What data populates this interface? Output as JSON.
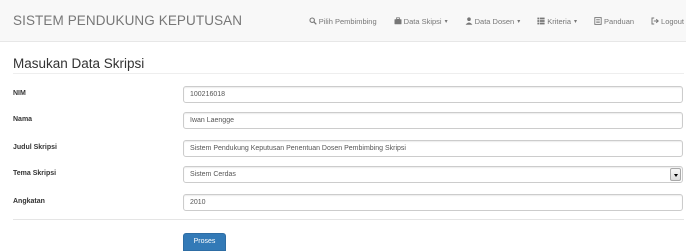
{
  "navbar": {
    "brand": "SISTEM PENDUKUNG KEPUTUSAN",
    "items": [
      {
        "label": "Pilih Pembimbing",
        "icon": "search-icon",
        "dropdown": false
      },
      {
        "label": "Data Skipsi",
        "icon": "briefcase-icon",
        "dropdown": true
      },
      {
        "label": "Data Dosen",
        "icon": "user-icon",
        "dropdown": true
      },
      {
        "label": "Kriteria",
        "icon": "list-icon",
        "dropdown": true
      },
      {
        "label": "Panduan",
        "icon": "book-icon",
        "dropdown": false
      },
      {
        "label": "Logout",
        "icon": "logout-icon",
        "dropdown": false
      }
    ]
  },
  "page": {
    "title": "Masukan Data Skripsi"
  },
  "form": {
    "nim": {
      "label": "NIM",
      "value": "100216018"
    },
    "nama": {
      "label": "Nama",
      "value": "Iwan Laengge"
    },
    "judul": {
      "label": "Judul Skripsi",
      "value": "Sistem Pendukung Keputusan Penentuan Dosen Pembimbing Skripsi"
    },
    "tema": {
      "label": "Tema Skripsi",
      "value": "Sistem Cerdas"
    },
    "angkatan": {
      "label": "Angkatan",
      "value": "2010"
    },
    "submit_label": "Proses"
  },
  "colors": {
    "navbar_bg": "#f8f8f8",
    "text_muted": "#777777",
    "primary": "#337ab7"
  }
}
